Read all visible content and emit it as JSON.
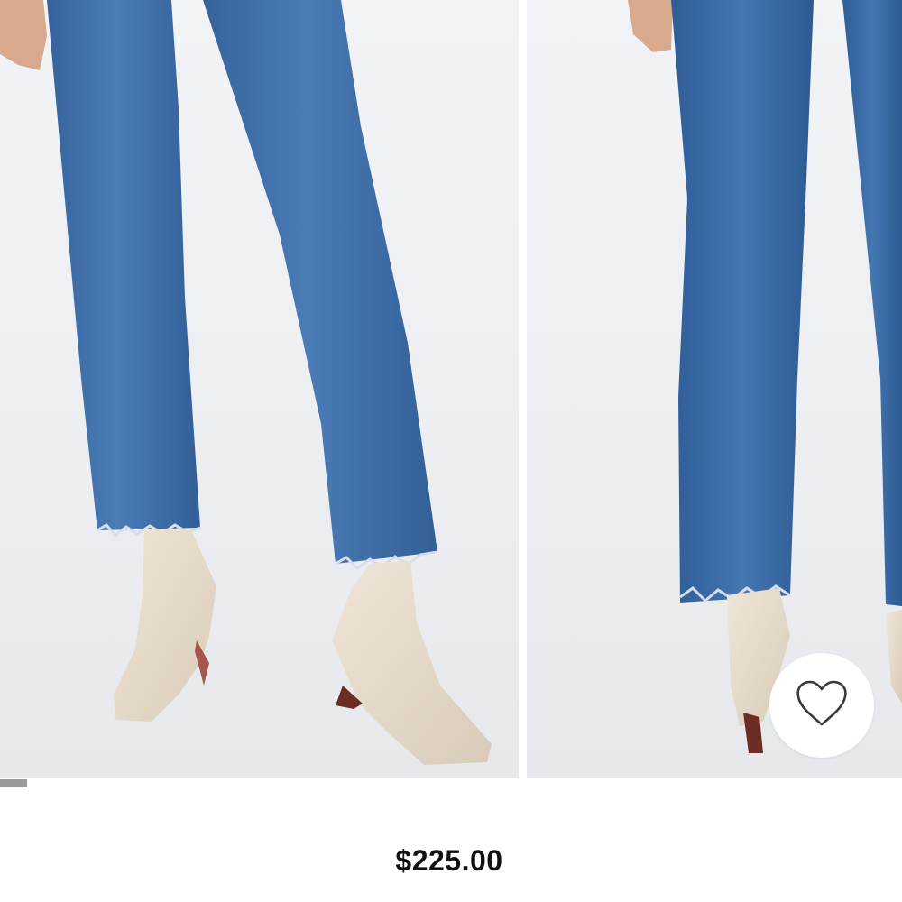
{
  "product": {
    "price": "$225.00",
    "images": [
      {
        "name": "front-view",
        "alt": ""
      },
      {
        "name": "side-view",
        "alt": ""
      }
    ],
    "image_count_visible": 2
  },
  "gallery": {
    "progress_fraction": 0.03
  },
  "icons": {
    "favorite": "heart-outline-icon"
  },
  "colors": {
    "denim": "#3f6fa8",
    "boot": "#e8dccd",
    "background": "#eef0f3",
    "price_text": "#111111"
  }
}
